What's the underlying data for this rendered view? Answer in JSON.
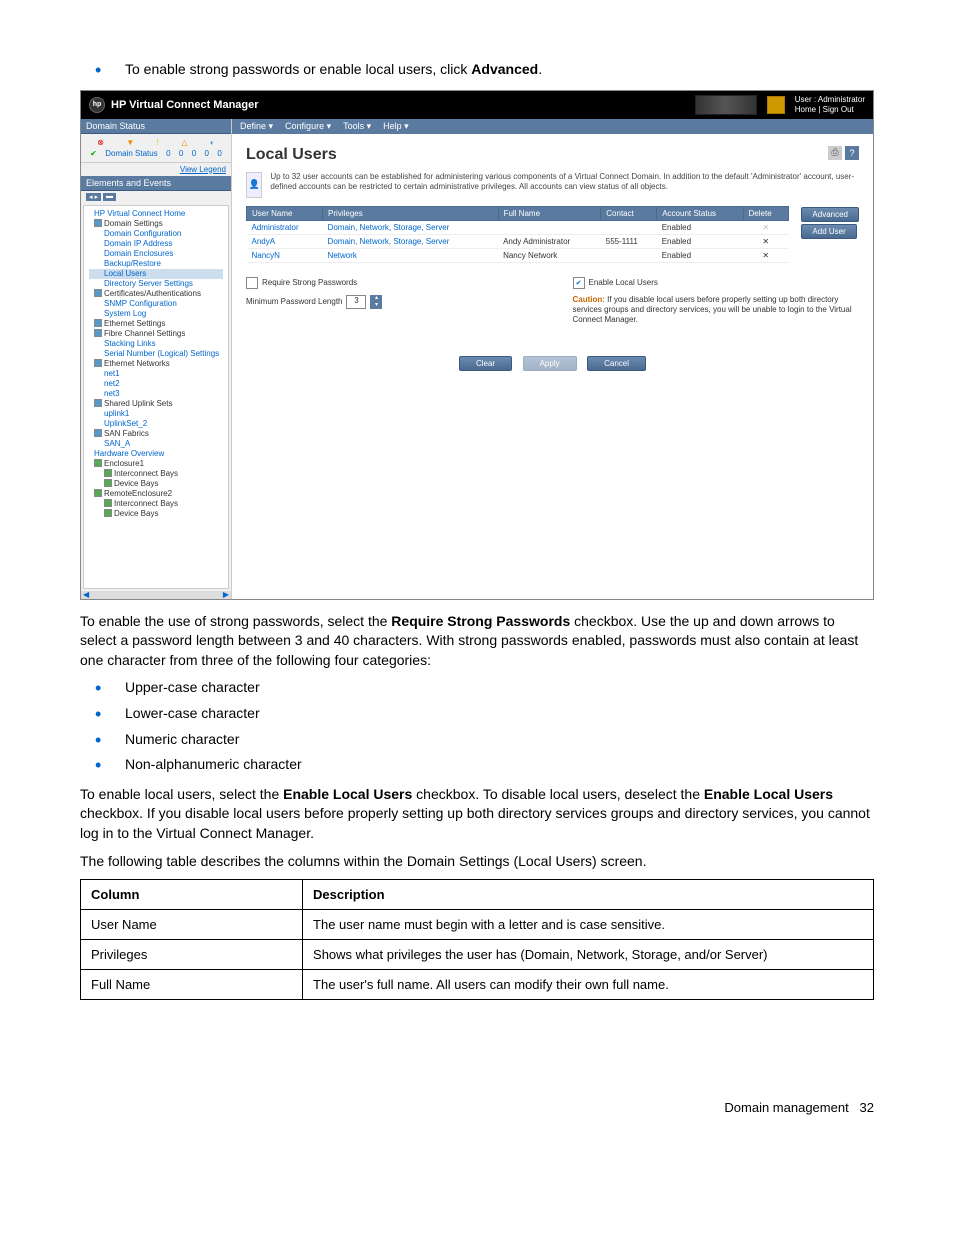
{
  "doc": {
    "intro_bullet_pre": "To enable strong passwords or enable local users, click ",
    "intro_bullet_bold": "Advanced",
    "intro_bullet_post": ".",
    "para1_pre": "To enable the use of strong passwords, select the ",
    "para1_b1": "Require Strong Passwords",
    "para1_post": " checkbox. Use the up and down arrows to select a password length between 3 and 40 characters. With strong passwords enabled, passwords must also contain at least one character from three of the following four categories:",
    "cat1": "Upper-case character",
    "cat2": "Lower-case character",
    "cat3": "Numeric character",
    "cat4": "Non-alphanumeric character",
    "para2_a": "To enable local users, select the ",
    "para2_b": "Enable Local Users",
    "para2_c": " checkbox. To disable local users, deselect the ",
    "para2_d": "Enable Local Users",
    "para2_e": " checkbox. If you disable local users before properly setting up both directory services groups and directory services, you cannot log in to the Virtual Connect Manager.",
    "para3": "The following table describes the columns within the Domain Settings (Local Users) screen.",
    "tbl_h1": "Column",
    "tbl_h2": "Description",
    "tbl_r1c1": "User Name",
    "tbl_r1c2": "The user name must begin with a letter and is case sensitive.",
    "tbl_r2c1": "Privileges",
    "tbl_r2c2": "Shows what privileges the user has (Domain, Network, Storage, and/or Server)",
    "tbl_r3c1": "Full Name",
    "tbl_r3c2": "The user's full name. All users can modify their own full name.",
    "footer_section": "Domain management",
    "footer_page": "32"
  },
  "ss": {
    "app_title": "HP Virtual Connect Manager",
    "user_label": "User : Administrator",
    "home_signout": "Home  |  Sign Out",
    "sidebar": {
      "domain_status": "Domain Status",
      "domain_status_label": "Domain Status",
      "counts": [
        "0",
        "0",
        "0",
        "0",
        "0"
      ],
      "view_legend": "View Legend",
      "elements_events": "Elements and Events",
      "tree": [
        {
          "t": "HP Virtual Connect Home",
          "lvl": 1,
          "link": true
        },
        {
          "t": "Domain Settings",
          "lvl": 1,
          "hdr": true,
          "sq": "b"
        },
        {
          "t": "Domain Configuration",
          "lvl": 2,
          "link": true
        },
        {
          "t": "Domain IP Address",
          "lvl": 2,
          "link": true
        },
        {
          "t": "Domain Enclosures",
          "lvl": 2,
          "link": true
        },
        {
          "t": "Backup/Restore",
          "lvl": 2,
          "link": true
        },
        {
          "t": "Local Users",
          "lvl": 2,
          "link": true,
          "sel": true
        },
        {
          "t": "Directory Server Settings",
          "lvl": 2,
          "link": true
        },
        {
          "t": "Certificates/Authentications",
          "lvl": 1,
          "hdr": true,
          "sq": "b"
        },
        {
          "t": "SNMP Configuration",
          "lvl": 2,
          "link": true
        },
        {
          "t": "System Log",
          "lvl": 2,
          "link": true
        },
        {
          "t": "Ethernet Settings",
          "lvl": 1,
          "hdr": true,
          "sq": "b"
        },
        {
          "t": "Fibre Channel Settings",
          "lvl": 1,
          "hdr": true,
          "sq": "b"
        },
        {
          "t": "Stacking Links",
          "lvl": 2,
          "link": true
        },
        {
          "t": "Serial Number (Logical) Settings",
          "lvl": 2,
          "link": true
        },
        {
          "t": "Ethernet Networks",
          "lvl": 1,
          "hdr": true,
          "sq": "b"
        },
        {
          "t": "net1",
          "lvl": 2,
          "link": true
        },
        {
          "t": "net2",
          "lvl": 2,
          "link": true
        },
        {
          "t": "net3",
          "lvl": 2,
          "link": true
        },
        {
          "t": "Shared Uplink Sets",
          "lvl": 1,
          "hdr": true,
          "sq": "b"
        },
        {
          "t": "uplink1",
          "lvl": 2,
          "link": true
        },
        {
          "t": "UplinkSet_2",
          "lvl": 2,
          "link": true
        },
        {
          "t": "SAN Fabrics",
          "lvl": 1,
          "hdr": true,
          "sq": "b"
        },
        {
          "t": "SAN_A",
          "lvl": 2,
          "link": true
        },
        {
          "t": "Hardware Overview",
          "lvl": 1,
          "link": true
        },
        {
          "t": "Enclosure1",
          "lvl": 1,
          "hdr": true,
          "sq": "g"
        },
        {
          "t": "Interconnect Bays",
          "lvl": 2,
          "hdr": true,
          "sq": "g"
        },
        {
          "t": "Device Bays",
          "lvl": 2,
          "hdr": true,
          "sq": "g"
        },
        {
          "t": "RemoteEnclosure2",
          "lvl": 1,
          "hdr": true,
          "sq": "g"
        },
        {
          "t": "Interconnect Bays",
          "lvl": 2,
          "hdr": true,
          "sq": "g"
        },
        {
          "t": "Device Bays",
          "lvl": 2,
          "hdr": true,
          "sq": "g"
        }
      ]
    },
    "menubar": [
      "Define ▾",
      "Configure ▾",
      "Tools ▾",
      "Help ▾"
    ],
    "page_title": "Local Users",
    "intro": "Up to 32 user accounts can be established for administering various components of a Virtual Connect Domain. In addition to the default 'Administrator' account, user-defined accounts can be restricted to certain administrative privileges. All accounts can view status of all objects.",
    "table": {
      "headers": [
        "User Name",
        "Privileges",
        "Full Name",
        "Contact",
        "Account Status",
        "Delete"
      ],
      "rows": [
        {
          "user": "Administrator",
          "priv": "Domain, Network, Storage, Server",
          "full": "",
          "contact": "",
          "status": "Enabled",
          "del": "✕",
          "del_dim": true
        },
        {
          "user": "AndyA",
          "priv": "Domain, Network, Storage, Server",
          "full": "Andy Administrator",
          "contact": "555-1111",
          "status": "Enabled",
          "del": "✕"
        },
        {
          "user": "NancyN",
          "priv": "Network",
          "full": "Nancy Network",
          "contact": "",
          "status": "Enabled",
          "del": "✕"
        }
      ]
    },
    "btn_advanced": "Advanced",
    "btn_adduser": "Add User",
    "chk_strong": "Require Strong Passwords",
    "min_len_label": "Minimum Password Length",
    "min_len_val": "3",
    "chk_local": "Enable Local Users",
    "caution_label": "Caution:",
    "caution_text": " If you disable local users before properly setting up both directory services groups and directory services, you will be unable to login to the Virtual Connect Manager.",
    "btn_clear": "Clear",
    "btn_apply": "Apply",
    "btn_cancel": "Cancel"
  }
}
